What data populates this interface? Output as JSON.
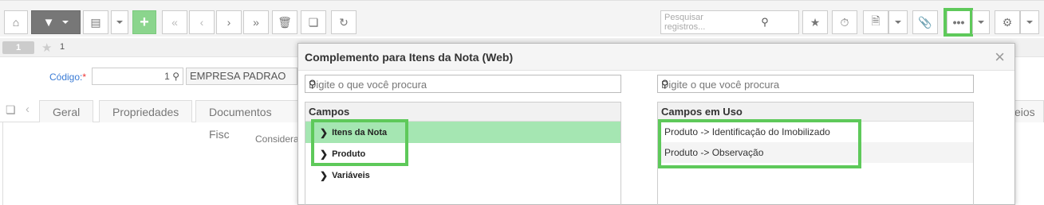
{
  "toolbar": {
    "search_placeholder": "Pesquisar registros...",
    "buttons": [
      "home",
      "filter",
      "list-view",
      "add",
      "first",
      "prev",
      "next",
      "last",
      "delete",
      "copy",
      "refresh",
      "favorite",
      "timer",
      "report",
      "attachment",
      "more",
      "settings"
    ],
    "highlight_color": "#5ec95a"
  },
  "record": {
    "badge": "1",
    "favorite_count": "1"
  },
  "form": {
    "codigo_label": "Código:",
    "required_mark": "*",
    "codigo_value": "1",
    "empresa_value": "EMPRESA PADRAO",
    "note": "Considera"
  },
  "tabs": [
    "Geral",
    "Propriedades",
    "Documentos Fisc",
    "eios"
  ],
  "modal": {
    "title": "Complemento para Itens da Nota (Web)",
    "left_search_placeholder": "Digite o que você procura",
    "right_search_placeholder": "Digite o que você procura",
    "fields_header": "Campos",
    "fields": [
      {
        "label": "Itens da Nota",
        "selected": true
      },
      {
        "label": "Produto",
        "selected": false
      },
      {
        "label": "Variáveis",
        "selected": false
      }
    ],
    "used_header": "Campos em Uso",
    "used_fields": [
      "Produto -> Identificação do Imobilizado",
      "Produto -> Observação"
    ]
  }
}
